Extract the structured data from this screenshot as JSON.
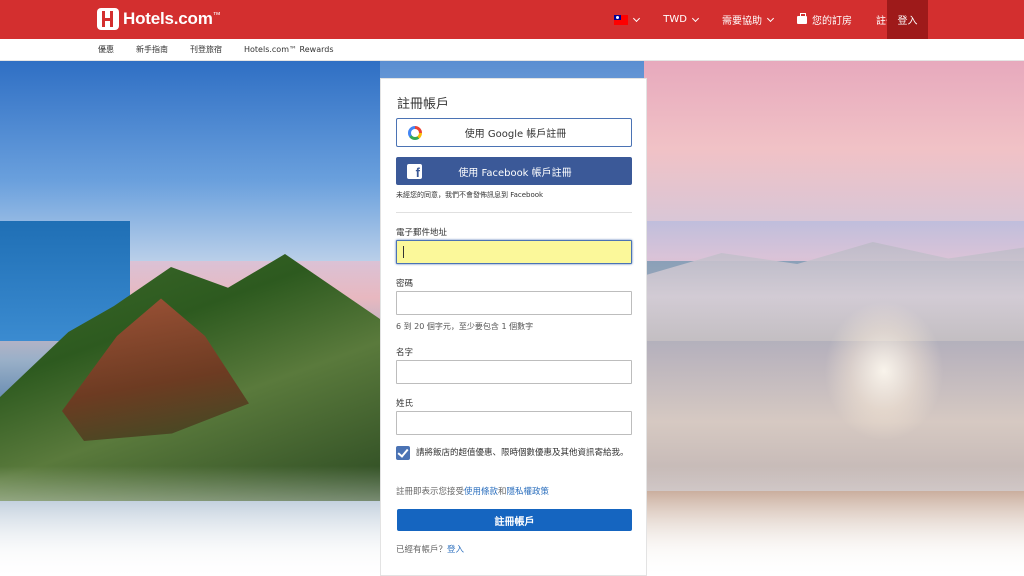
{
  "header": {
    "logo_text": "Hotels.com",
    "logo_tm": "™",
    "currency": "TWD",
    "help": "需要協助",
    "bookings": "您的訂房",
    "register": "註冊帳戶",
    "login": "登入"
  },
  "subnav": {
    "items": [
      "優惠",
      "新手指南",
      "刊登旅宿",
      "Hotels.com™ Rewards"
    ]
  },
  "form": {
    "title": "註冊帳戶",
    "google_label": "使用 Google 帳戶註冊",
    "facebook_label": "使用 Facebook 帳戶註冊",
    "facebook_note": "未經您的同意，我們不會發佈訊息到 Facebook",
    "email_label": "電子郵件地址",
    "email_value": "",
    "password_label": "密碼",
    "password_hint": "6 到 20 個字元，至少要包含 1 個數字",
    "first_name_label": "名字",
    "last_name_label": "姓氏",
    "newsletter_text": "請將飯店的超值優惠、限時個數優惠及其他資訊寄給我。",
    "newsletter_checked": true,
    "terms_prefix": "註冊即表示您接受",
    "terms_link": "使用條款",
    "terms_and": "和",
    "privacy_link": "隱私權政策",
    "submit_label": "註冊帳戶",
    "have_account_text": "已經有帳戶？",
    "login_link": "登入"
  },
  "colors": {
    "header_red": "#d32f2f",
    "login_dark_red": "#9e1a1a",
    "facebook_blue": "#3b5998",
    "primary_blue": "#1565c0",
    "focus_yellow": "#fbf89a"
  }
}
